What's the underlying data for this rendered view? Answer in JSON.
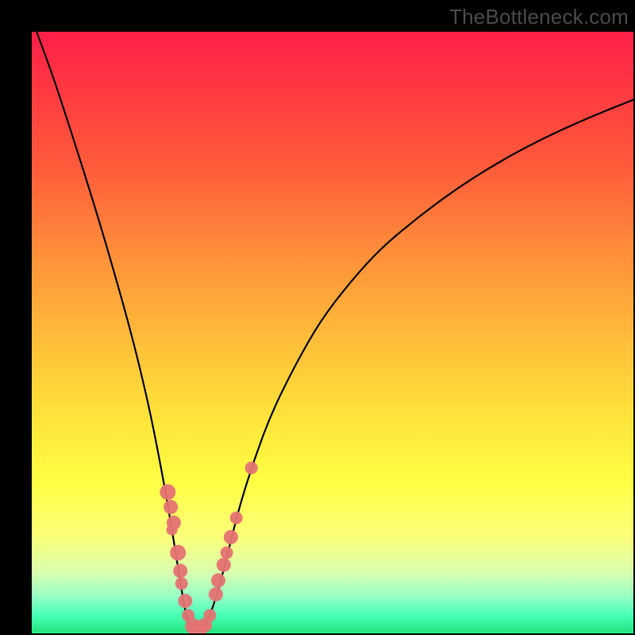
{
  "watermark": "TheBottleneck.com",
  "colors": {
    "background": "#000000",
    "curve_stroke": "#000000",
    "marker_fill": "#e57373",
    "marker_stroke": "#c85a5a"
  },
  "chart_data": {
    "type": "line",
    "title": "",
    "xlabel": "",
    "ylabel": "",
    "xlim": [
      0,
      100
    ],
    "ylim": [
      0,
      100
    ],
    "curve_approx": [
      {
        "x": 0.8,
        "y": 100.0
      },
      {
        "x": 3.0,
        "y": 94.2
      },
      {
        "x": 6.0,
        "y": 85.1
      },
      {
        "x": 9.0,
        "y": 75.7
      },
      {
        "x": 12.0,
        "y": 65.9
      },
      {
        "x": 15.0,
        "y": 55.5
      },
      {
        "x": 17.5,
        "y": 46.1
      },
      {
        "x": 19.5,
        "y": 37.6
      },
      {
        "x": 21.0,
        "y": 30.1
      },
      {
        "x": 22.5,
        "y": 22.0
      },
      {
        "x": 24.0,
        "y": 13.0
      },
      {
        "x": 25.3,
        "y": 4.7
      },
      {
        "x": 26.2,
        "y": 1.0
      },
      {
        "x": 27.0,
        "y": 0.5
      },
      {
        "x": 27.8,
        "y": 0.5
      },
      {
        "x": 28.8,
        "y": 1.1
      },
      {
        "x": 30.0,
        "y": 4.0
      },
      {
        "x": 31.5,
        "y": 9.0
      },
      {
        "x": 33.0,
        "y": 15.0
      },
      {
        "x": 34.5,
        "y": 21.0
      },
      {
        "x": 37.0,
        "y": 29.0
      },
      {
        "x": 40.0,
        "y": 37.0
      },
      {
        "x": 44.0,
        "y": 45.0
      },
      {
        "x": 48.0,
        "y": 52.0
      },
      {
        "x": 53.0,
        "y": 58.5
      },
      {
        "x": 58.0,
        "y": 64.0
      },
      {
        "x": 64.0,
        "y": 69.0
      },
      {
        "x": 70.0,
        "y": 73.5
      },
      {
        "x": 77.0,
        "y": 78.0
      },
      {
        "x": 84.0,
        "y": 81.8
      },
      {
        "x": 92.0,
        "y": 85.5
      },
      {
        "x": 100.5,
        "y": 88.9
      }
    ],
    "markers": [
      {
        "x": 22.6,
        "y": 23.5,
        "r": 10
      },
      {
        "x": 23.1,
        "y": 21.0,
        "r": 9
      },
      {
        "x": 23.6,
        "y": 18.4,
        "r": 9
      },
      {
        "x": 23.3,
        "y": 17.2,
        "r": 7
      },
      {
        "x": 24.3,
        "y": 13.4,
        "r": 10
      },
      {
        "x": 24.7,
        "y": 10.4,
        "r": 9
      },
      {
        "x": 24.9,
        "y": 8.3,
        "r": 8
      },
      {
        "x": 25.5,
        "y": 5.4,
        "r": 9
      },
      {
        "x": 26.0,
        "y": 3.0,
        "r": 8
      },
      {
        "x": 26.8,
        "y": 1.2,
        "r": 10
      },
      {
        "x": 27.2,
        "y": 0.9,
        "r": 9
      },
      {
        "x": 28.0,
        "y": 0.9,
        "r": 10
      },
      {
        "x": 28.8,
        "y": 1.4,
        "r": 9
      },
      {
        "x": 29.6,
        "y": 3.0,
        "r": 8
      },
      {
        "x": 30.6,
        "y": 6.5,
        "r": 9
      },
      {
        "x": 31.0,
        "y": 8.8,
        "r": 9
      },
      {
        "x": 31.9,
        "y": 11.4,
        "r": 9
      },
      {
        "x": 32.4,
        "y": 13.4,
        "r": 8
      },
      {
        "x": 33.1,
        "y": 16.0,
        "r": 9
      },
      {
        "x": 34.0,
        "y": 19.2,
        "r": 8
      },
      {
        "x": 36.5,
        "y": 27.5,
        "r": 8
      }
    ]
  }
}
